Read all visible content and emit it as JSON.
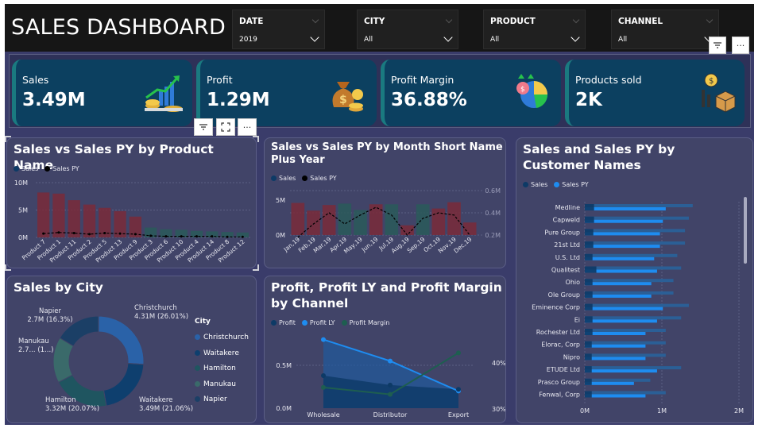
{
  "header": {
    "title": "SALES DASHBOARD"
  },
  "slicers": [
    {
      "label": "DATE",
      "value": "2019"
    },
    {
      "label": "CITY",
      "value": "All"
    },
    {
      "label": "PRODUCT",
      "value": "All"
    },
    {
      "label": "CHANNEL",
      "value": "All"
    }
  ],
  "icons": {
    "filter": "filter-icon",
    "more": "more-options-icon",
    "focus": "focus-mode-icon"
  },
  "kpis": [
    {
      "label": "Sales",
      "value": "3.49M",
      "icon": "money-growth-icon"
    },
    {
      "label": "Profit",
      "value": "1.29M",
      "icon": "money-bag-icon"
    },
    {
      "label": "Profit Margin",
      "value": "36.88%",
      "icon": "pie-chart-money-icon"
    },
    {
      "label": "Products sold",
      "value": "2K",
      "icon": "boxes-dollar-icon"
    }
  ],
  "colors": {
    "sales": "#0d3a66",
    "sales_py": "#000000",
    "bar_dark": "#7a2a3a",
    "bar_green": "#2a5a5a",
    "accent": "#1e8cf0",
    "profit": "#0d3a66",
    "profit_ly": "#1e8cf0",
    "profit_margin": "#1e5e50"
  },
  "charts": {
    "product": {
      "title": "Sales vs Sales PY by Product Name",
      "legend": [
        "Sales",
        "Sales PY"
      ],
      "yticks": [
        "10M",
        "5M",
        "0M"
      ]
    },
    "month": {
      "title": "Sales vs Sales PY by Month Short Name Plus Year",
      "legend": [
        "Sales",
        "Sales PY"
      ],
      "yticks": [
        "5M",
        "0M"
      ],
      "y2ticks": [
        "0.6M",
        "0.4M",
        "0.2M"
      ]
    },
    "customer": {
      "title": "Sales and Sales PY by Customer Names",
      "legend": [
        "Sales",
        "Sales PY"
      ],
      "xticks": [
        "0M",
        "1M",
        "2M"
      ]
    },
    "city": {
      "title": "Sales by City",
      "legend_title": "City",
      "legend": [
        "Christchurch",
        "Waitakere",
        "Hamilton",
        "Manukau",
        "Napier"
      ],
      "labels": [
        {
          "name": "Napier",
          "value": "2.7M (16.3%)"
        },
        {
          "name": "Christchurch",
          "value": "4.31M (26.01%)"
        },
        {
          "name": "Manukau",
          "value": "2.7... (1...)"
        },
        {
          "name": "Hamilton",
          "value": "3.32M (20.07%)"
        },
        {
          "name": "Waitakere",
          "value": "3.49M (21.06%)"
        }
      ]
    },
    "channel": {
      "title": "Profit, Profit LY and Profit Margin by Channel",
      "legend": [
        "Profit",
        "Profit LY",
        "Profit Margin"
      ],
      "yticks": [
        "0.5M",
        "0.0M"
      ],
      "y2ticks": [
        "40%",
        "30%"
      ]
    }
  },
  "chart_data": [
    {
      "type": "bar",
      "title": "Sales vs Sales PY by Product Name",
      "categories": [
        "Product 7",
        "Product 1",
        "Product 11",
        "Product 2",
        "Product 5",
        "Product 13",
        "Product 9",
        "Product 3",
        "Product 6",
        "Product 10",
        "Product 4",
        "Product 14",
        "Product 8",
        "Product 12"
      ],
      "series": [
        {
          "name": "Sales",
          "values": [
            8.2,
            8.0,
            6.8,
            6.0,
            5.4,
            4.8,
            3.8,
            1.8,
            1.5,
            1.4,
            1.2,
            1.1,
            1.0,
            0.9
          ]
        },
        {
          "name": "Sales PY",
          "values": [
            0.7,
            0.9,
            0.8,
            0.6,
            0.8,
            0.7,
            0.6,
            0.3,
            0.2,
            0.2,
            0.2,
            0.2,
            0.1,
            0.1
          ]
        }
      ],
      "ylim": [
        0,
        10
      ]
    },
    {
      "type": "bar",
      "title": "Sales vs Sales PY by Month Short Name Plus Year",
      "categories": [
        "Jan,19",
        "Feb,19",
        "Mar,19",
        "Apr,19",
        "May,19",
        "Jun,19",
        "Jul,19",
        "Aug,19",
        "Sep,19",
        "Oct,19",
        "Nov,19",
        "Dec,19"
      ],
      "series": [
        {
          "name": "Sales",
          "values": [
            4.6,
            3.5,
            4.3,
            4.5,
            3.6,
            4.4,
            4.4,
            1.4,
            4.4,
            3.8,
            4.7,
            1.8
          ]
        },
        {
          "name": "Sales PY",
          "values": [
            0.18,
            0.3,
            0.4,
            0.3,
            0.38,
            0.45,
            0.38,
            0.2,
            0.35,
            0.4,
            0.38,
            0.2
          ]
        }
      ],
      "ylim": [
        0,
        5
      ],
      "y2lim": [
        0.2,
        0.6
      ]
    },
    {
      "type": "bar",
      "title": "Sales and Sales PY by Customer Names",
      "categories": [
        "Medline",
        "Capweld",
        "Pure Group",
        "21st Ltd",
        "U.S. Ltd",
        "Qualitest",
        "Ohio",
        "Ole Group",
        "Eminence Corp",
        "Ei",
        "Rochester Ltd",
        "Elorac, Corp",
        "Nipro",
        "ETUDE Ltd",
        "Prasco Group",
        "Fenwal, Corp"
      ],
      "series": [
        {
          "name": "Sales",
          "values": [
            0.12,
            0.12,
            0.11,
            0.11,
            0.1,
            0.15,
            0.1,
            0.1,
            0.1,
            0.1,
            0.1,
            0.09,
            0.09,
            0.09,
            0.09,
            0.09
          ]
        },
        {
          "name": "Sales PY",
          "values": [
            1.4,
            1.35,
            1.3,
            1.3,
            1.2,
            1.25,
            1.15,
            1.15,
            1.35,
            1.25,
            1.05,
            1.05,
            1.05,
            1.25,
            0.85,
            1.05
          ]
        }
      ],
      "xlim": [
        0,
        2
      ]
    },
    {
      "type": "pie",
      "title": "Sales by City",
      "categories": [
        "Christchurch",
        "Waitakere",
        "Hamilton",
        "Manukau",
        "Napier"
      ],
      "values": [
        4.31,
        3.49,
        3.32,
        2.7,
        2.7
      ]
    },
    {
      "type": "line",
      "title": "Profit, Profit LY and Profit Margin by Channel",
      "categories": [
        "Wholesale",
        "Distributor",
        "Export"
      ],
      "series": [
        {
          "name": "Profit",
          "values": [
            0.38,
            0.27,
            0.22
          ]
        },
        {
          "name": "Profit LY",
          "values": [
            0.8,
            0.55,
            0.2
          ]
        },
        {
          "name": "Profit Margin",
          "values": [
            34.5,
            33.0,
            42.0
          ]
        }
      ],
      "ylim": [
        0,
        1
      ],
      "y2lim": [
        30,
        40
      ]
    }
  ]
}
